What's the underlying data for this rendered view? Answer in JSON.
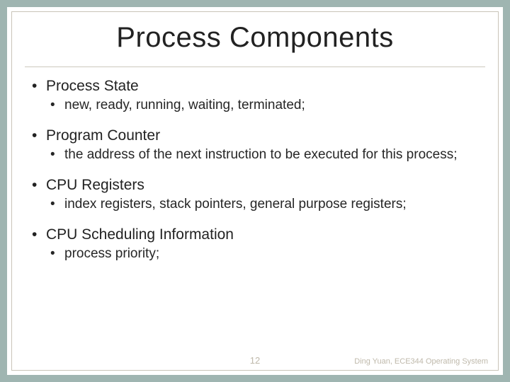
{
  "title": "Process Components",
  "sections": [
    {
      "heading": "Process State",
      "detail": "new, ready, running, waiting, terminated;"
    },
    {
      "heading": "Program Counter",
      "detail": "the address of the next instruction to be executed for this process;"
    },
    {
      "heading": "CPU Registers",
      "detail": "index registers, stack pointers, general purpose registers;"
    },
    {
      "heading": "CPU Scheduling Information",
      "detail": "process priority;"
    }
  ],
  "page_number": "12",
  "footer": "Ding Yuan, ECE344 Operating System"
}
